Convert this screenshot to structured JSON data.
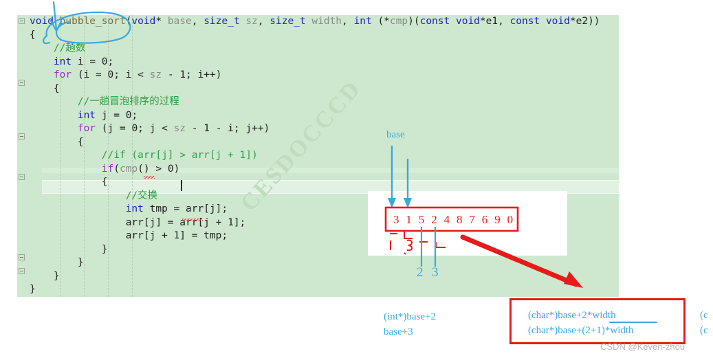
{
  "editor": {
    "language": "c",
    "background_color": "#cde8ce",
    "lines": [
      {
        "indent": 0,
        "tokens": [
          {
            "t": "void ",
            "c": "kw"
          },
          {
            "t": "bubble_sort",
            "c": "fn"
          },
          {
            "t": "(",
            "c": "plain"
          },
          {
            "t": "void",
            "c": "kw"
          },
          {
            "t": "* ",
            "c": "plain"
          },
          {
            "t": "base",
            "c": "var"
          },
          {
            "t": ", ",
            "c": "plain"
          },
          {
            "t": "size_t",
            "c": "kw"
          },
          {
            "t": " ",
            "c": "plain"
          },
          {
            "t": "sz",
            "c": "var"
          },
          {
            "t": ", ",
            "c": "plain"
          },
          {
            "t": "size_t",
            "c": "kw"
          },
          {
            "t": " ",
            "c": "plain"
          },
          {
            "t": "width",
            "c": "var"
          },
          {
            "t": ", ",
            "c": "plain"
          },
          {
            "t": "int",
            "c": "kw"
          },
          {
            "t": " (*",
            "c": "plain"
          },
          {
            "t": "cmp",
            "c": "var"
          },
          {
            "t": ")(",
            "c": "plain"
          },
          {
            "t": "const",
            "c": "kw"
          },
          {
            "t": " ",
            "c": "plain"
          },
          {
            "t": "void",
            "c": "kw"
          },
          {
            "t": "*e1, ",
            "c": "plain"
          },
          {
            "t": "const",
            "c": "kw"
          },
          {
            "t": " ",
            "c": "plain"
          },
          {
            "t": "void",
            "c": "kw"
          },
          {
            "t": "*e2))",
            "c": "plain"
          }
        ]
      },
      {
        "indent": 0,
        "tokens": [
          {
            "t": "{",
            "c": "plain"
          }
        ]
      },
      {
        "indent": 1,
        "tokens": [
          {
            "t": "//趟数",
            "c": "cmt"
          }
        ]
      },
      {
        "indent": 1,
        "tokens": [
          {
            "t": "int",
            "c": "kw"
          },
          {
            "t": " i = ",
            "c": "plain"
          },
          {
            "t": "0",
            "c": "num"
          },
          {
            "t": ";",
            "c": "plain"
          }
        ]
      },
      {
        "indent": 1,
        "tokens": [
          {
            "t": "for",
            "c": "kwflow"
          },
          {
            "t": " (i = ",
            "c": "plain"
          },
          {
            "t": "0",
            "c": "num"
          },
          {
            "t": "; i < ",
            "c": "plain"
          },
          {
            "t": "sz",
            "c": "var"
          },
          {
            "t": " - ",
            "c": "plain"
          },
          {
            "t": "1",
            "c": "num"
          },
          {
            "t": "; i++)",
            "c": "plain"
          }
        ]
      },
      {
        "indent": 1,
        "tokens": [
          {
            "t": "{",
            "c": "plain"
          }
        ]
      },
      {
        "indent": 2,
        "tokens": [
          {
            "t": "//一趟冒泡排序的过程",
            "c": "cmt"
          }
        ]
      },
      {
        "indent": 2,
        "tokens": [
          {
            "t": "int",
            "c": "kw"
          },
          {
            "t": " j = ",
            "c": "plain"
          },
          {
            "t": "0",
            "c": "num"
          },
          {
            "t": ";",
            "c": "plain"
          }
        ]
      },
      {
        "indent": 2,
        "tokens": [
          {
            "t": "for",
            "c": "kwflow"
          },
          {
            "t": " (j = ",
            "c": "plain"
          },
          {
            "t": "0",
            "c": "num"
          },
          {
            "t": "; j < ",
            "c": "plain"
          },
          {
            "t": "sz",
            "c": "var"
          },
          {
            "t": " - ",
            "c": "plain"
          },
          {
            "t": "1",
            "c": "num"
          },
          {
            "t": " - i; j++)",
            "c": "plain"
          }
        ]
      },
      {
        "indent": 2,
        "tokens": [
          {
            "t": "{",
            "c": "plain"
          }
        ]
      },
      {
        "indent": 3,
        "tokens": [
          {
            "t": "//if (arr[j] > arr[j + 1])",
            "c": "cmt"
          }
        ]
      },
      {
        "indent": 3,
        "tokens": [
          {
            "t": "if",
            "c": "kwflow"
          },
          {
            "t": "(",
            "c": "plain"
          },
          {
            "t": "cmp",
            "c": "var"
          },
          {
            "t": "() > ",
            "c": "plain"
          },
          {
            "t": "0",
            "c": "num"
          },
          {
            "t": ")",
            "c": "plain"
          }
        ]
      },
      {
        "indent": 3,
        "tokens": [
          {
            "t": "{",
            "c": "plain"
          }
        ]
      },
      {
        "indent": 4,
        "tokens": [
          {
            "t": "//交换",
            "c": "cmt"
          }
        ]
      },
      {
        "indent": 4,
        "tokens": [
          {
            "t": "int",
            "c": "kw"
          },
          {
            "t": " tmp = arr[j];",
            "c": "plain"
          }
        ]
      },
      {
        "indent": 4,
        "tokens": [
          {
            "t": "arr[j] = arr[j + ",
            "c": "plain"
          },
          {
            "t": "1",
            "c": "num"
          },
          {
            "t": "];",
            "c": "plain"
          }
        ]
      },
      {
        "indent": 4,
        "tokens": [
          {
            "t": "arr[j + ",
            "c": "plain"
          },
          {
            "t": "1",
            "c": "num"
          },
          {
            "t": "] = tmp;",
            "c": "plain"
          }
        ]
      },
      {
        "indent": 3,
        "tokens": [
          {
            "t": "}",
            "c": "plain"
          }
        ]
      },
      {
        "indent": 2,
        "tokens": [
          {
            "t": "}",
            "c": "plain"
          }
        ]
      },
      {
        "indent": 1,
        "tokens": [
          {
            "t": "}",
            "c": "plain"
          }
        ]
      },
      {
        "indent": 0,
        "tokens": [
          {
            "t": "}",
            "c": "plain"
          }
        ]
      }
    ],
    "watermark": "CESDOCCCD"
  },
  "diagram": {
    "base_label": "base",
    "array_values": [
      "3",
      "1",
      "5",
      "2",
      "4",
      "8",
      "7",
      "6",
      "9",
      "0"
    ],
    "pointer_marks_blue": [
      "2",
      "3"
    ],
    "array_box_color": "#e81a1a",
    "pointer_color": "#3aa8de",
    "big_arrow_color": "#e81a1a"
  },
  "annotations": {
    "left_note": "(int*)base+2\nbase+3",
    "boxed_note": "(char*)base+2*width\n(char*)base+(2+1)*width",
    "right_clipped_note": "(c\n(c",
    "watermark_credit": "CSDN @Keven-zhou"
  }
}
